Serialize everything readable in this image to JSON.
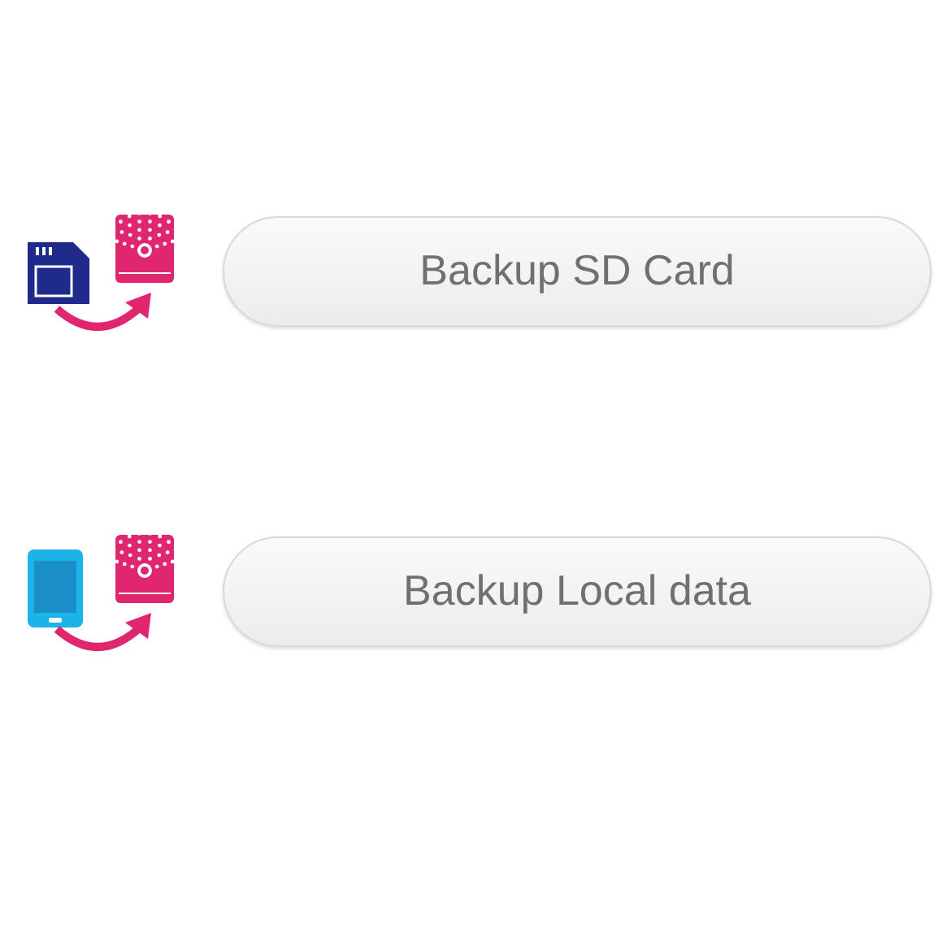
{
  "actions": [
    {
      "kind": "sd-card",
      "label": "Backup SD Card"
    },
    {
      "kind": "phone",
      "label": "Backup Local data"
    }
  ]
}
